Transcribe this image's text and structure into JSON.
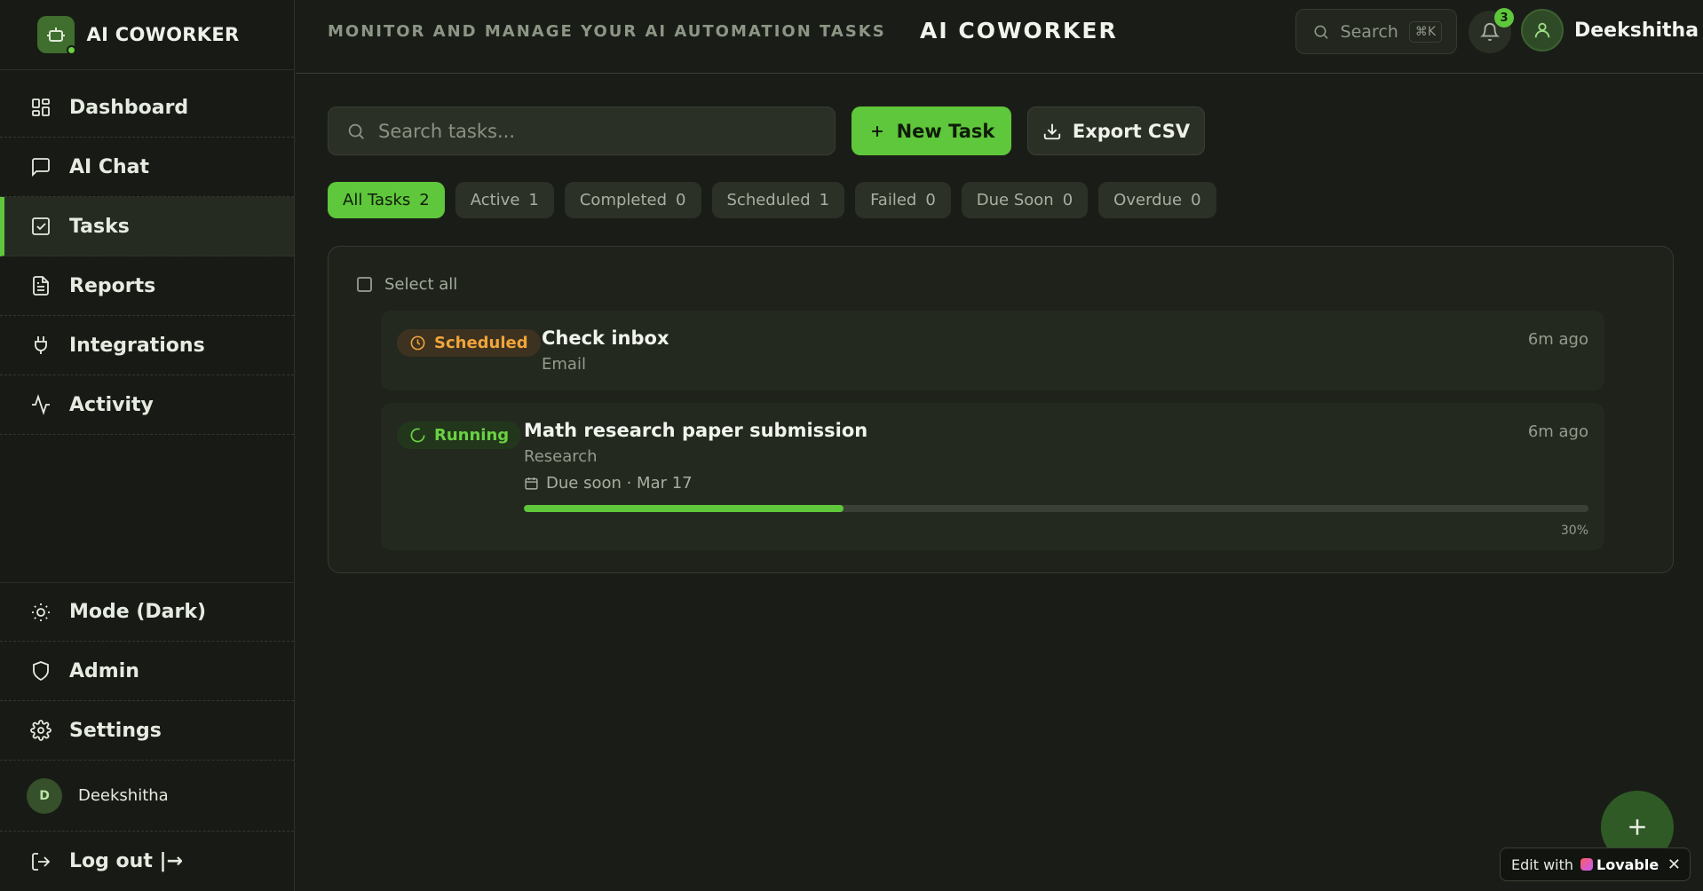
{
  "brand": {
    "name": "AI COWORKER"
  },
  "sidebar": {
    "items": [
      {
        "label": "Dashboard",
        "icon": "grid-icon"
      },
      {
        "label": "AI Chat",
        "icon": "message-icon"
      },
      {
        "label": "Tasks",
        "icon": "checkbox-icon",
        "active": true
      },
      {
        "label": "Reports",
        "icon": "document-icon"
      },
      {
        "label": "Integrations",
        "icon": "plug-icon"
      },
      {
        "label": "Activity",
        "icon": "activity-icon"
      }
    ],
    "bottom": [
      {
        "label": "Mode (Dark)",
        "icon": "sun-icon"
      },
      {
        "label": "Admin",
        "icon": "shield-icon"
      },
      {
        "label": "Settings",
        "icon": "gear-icon"
      }
    ],
    "user": {
      "initial": "D",
      "name": "Deekshitha"
    },
    "logout": "Log out |→"
  },
  "header": {
    "subtitle": "MONITOR AND MANAGE YOUR AI AUTOMATION TASKS",
    "title": "AI COWORKER",
    "search_label": "Search",
    "search_shortcut": "⌘K",
    "notifications_count": "3",
    "username": "Deekshitha"
  },
  "toolbar": {
    "search_placeholder": "Search tasks...",
    "new_task": "New Task",
    "export": "Export CSV"
  },
  "filters": [
    {
      "label": "All Tasks",
      "count": "2",
      "active": true
    },
    {
      "label": "Active",
      "count": "1"
    },
    {
      "label": "Completed",
      "count": "0"
    },
    {
      "label": "Scheduled",
      "count": "1"
    },
    {
      "label": "Failed",
      "count": "0"
    },
    {
      "label": "Due Soon",
      "count": "0"
    },
    {
      "label": "Overdue",
      "count": "0"
    }
  ],
  "tasks": {
    "select_all": "Select all",
    "items": [
      {
        "status": "Scheduled",
        "title": "Check inbox",
        "category": "Email",
        "time": "6m ago"
      },
      {
        "status": "Running",
        "title": "Math research paper submission",
        "category": "Research",
        "due": "Due soon · Mar 17",
        "time": "6m ago",
        "progress": 0.3,
        "progress_label": "30%"
      }
    ]
  },
  "lovable": {
    "prefix": "Edit with",
    "brand": "Lovable",
    "close": "✕"
  },
  "colors": {
    "accent": "#5fc73b",
    "scheduled": "#f0a53a",
    "background": "#1a1d17"
  }
}
